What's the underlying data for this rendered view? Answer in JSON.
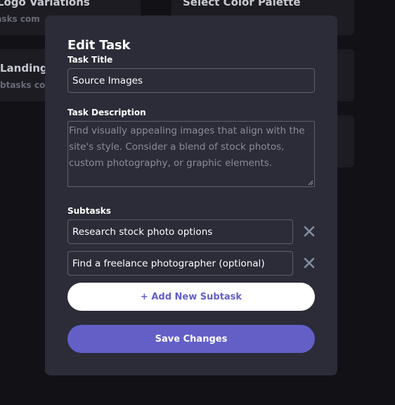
{
  "background": {
    "cards": [
      {
        "title": "n Logo Variations",
        "subtitle": "btasks com"
      },
      {
        "title": "Select Color Palette",
        "subtitle": ""
      },
      {
        "title": "Landing P",
        "subtitle": "btasks com"
      }
    ]
  },
  "modal": {
    "title": "Edit Task",
    "task_title_label": "Task Title",
    "task_title_value": "Source Images",
    "description_label": "Task Description",
    "description_value": "Find visually appealing images that align with the site's style. Consider a blend of stock photos, custom photography, or graphic elements.",
    "subtasks_label": "Subtasks",
    "subtasks": [
      {
        "value": "Research stock photo options"
      },
      {
        "value": "Find a freelance photographer (optional)"
      }
    ],
    "add_subtask_label": "+ Add New Subtask",
    "save_label": "Save Changes"
  },
  "colors": {
    "accent": "#635fc7",
    "modal_bg": "#2b2c37",
    "page_bg": "#111116"
  },
  "icons": {
    "remove": "close-icon"
  }
}
